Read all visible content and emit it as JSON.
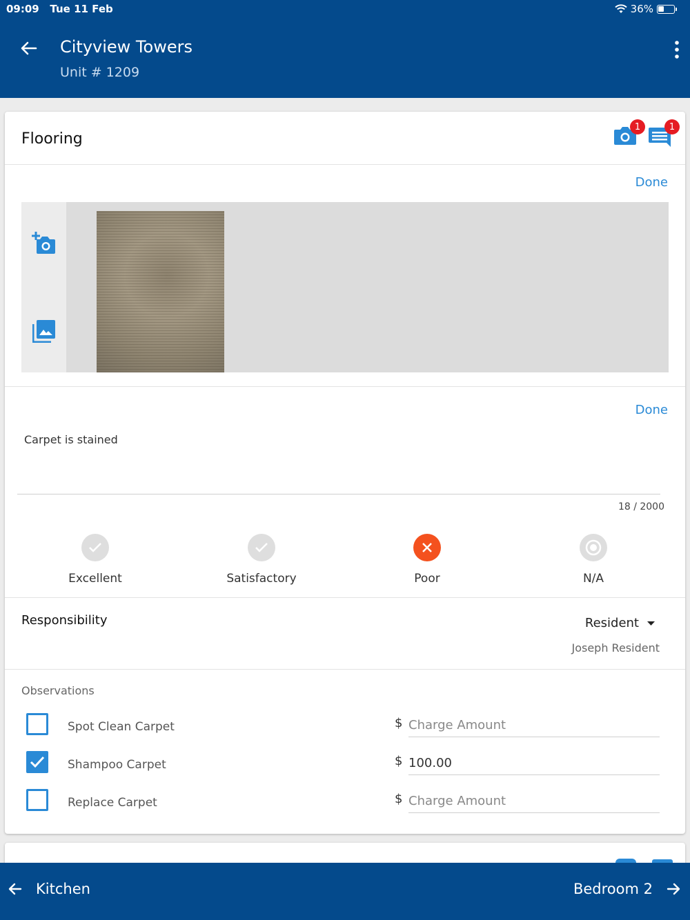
{
  "status_bar": {
    "time": "09:09",
    "date": "Tue 11 Feb",
    "battery": "36%",
    "icons": [
      "wifi-icon",
      "battery-icon"
    ]
  },
  "header": {
    "title": "Cityview Towers",
    "subtitle": "Unit # 1209",
    "back_icon": "arrow-left-icon",
    "menu_icon": "more-vertical-icon"
  },
  "section": {
    "title": "Flooring",
    "photo_badge": "1",
    "comment_badge": "1",
    "photos_done_label": "Done",
    "comment_done_label": "Done"
  },
  "comment": {
    "text": "Carpet is stained",
    "char_count": "18 / 2000"
  },
  "ratings": [
    {
      "label": "Excellent",
      "selected": false
    },
    {
      "label": "Satisfactory",
      "selected": false
    },
    {
      "label": "Poor",
      "selected": true
    },
    {
      "label": "N/A",
      "selected": false
    }
  ],
  "responsibility": {
    "label": "Responsibility",
    "selected": "Resident",
    "name": "Joseph Resident"
  },
  "observations": {
    "title": "Observations",
    "currency": "$",
    "placeholder": "Charge Amount",
    "items": [
      {
        "label": "Spot Clean Carpet",
        "checked": false,
        "amount": ""
      },
      {
        "label": "Shampoo Carpet",
        "checked": true,
        "amount": "100.00"
      },
      {
        "label": "Replace Carpet",
        "checked": false,
        "amount": ""
      }
    ]
  },
  "footer": {
    "prev_label": "Kitchen",
    "next_label": "Bedroom 2"
  },
  "colors": {
    "header_bg": "#044a8c",
    "accent": "#2a8ad6",
    "poor": "#f4511e",
    "badge": "#e51c23"
  }
}
